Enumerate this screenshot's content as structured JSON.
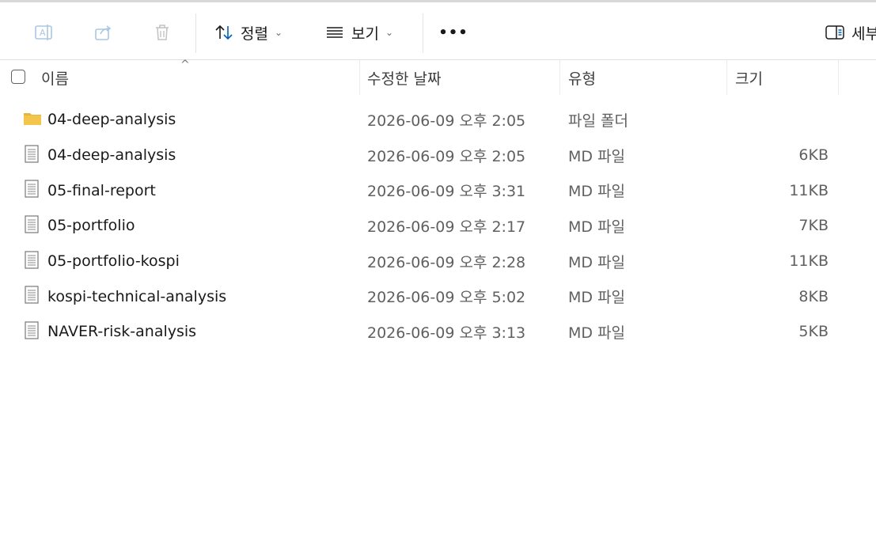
{
  "toolbar": {
    "sort_label": "정렬",
    "view_label": "보기",
    "more_label": "•••",
    "details_label": "세부"
  },
  "columns": {
    "name": "이름",
    "modified": "수정한 날짜",
    "type": "유형",
    "size": "크기"
  },
  "files": [
    {
      "name": "04-deep-analysis",
      "modified": "2026-06-09 오후 2:05",
      "type": "파일 폴더",
      "size": "",
      "icon": "folder-icon"
    },
    {
      "name": "04-deep-analysis",
      "modified": "2026-06-09 오후 2:05",
      "type": "MD 파일",
      "size": "6KB",
      "icon": "document-icon"
    },
    {
      "name": "05-final-report",
      "modified": "2026-06-09 오후 3:31",
      "type": "MD 파일",
      "size": "11KB",
      "icon": "document-icon"
    },
    {
      "name": "05-portfolio",
      "modified": "2026-06-09 오후 2:17",
      "type": "MD 파일",
      "size": "7KB",
      "icon": "document-icon"
    },
    {
      "name": "05-portfolio-kospi",
      "modified": "2026-06-09 오후 2:28",
      "type": "MD 파일",
      "size": "11KB",
      "icon": "document-icon"
    },
    {
      "name": "kospi-technical-analysis",
      "modified": "2026-06-09 오후 5:02",
      "type": "MD 파일",
      "size": "8KB",
      "icon": "document-icon"
    },
    {
      "name": "NAVER-risk-analysis",
      "modified": "2026-06-09 오후 3:13",
      "type": "MD 파일",
      "size": "5KB",
      "icon": "document-icon"
    }
  ],
  "colors": {
    "folder": "#f3c64b",
    "accent": "#005fb8",
    "disabled_icon": "#a9c7e3"
  }
}
